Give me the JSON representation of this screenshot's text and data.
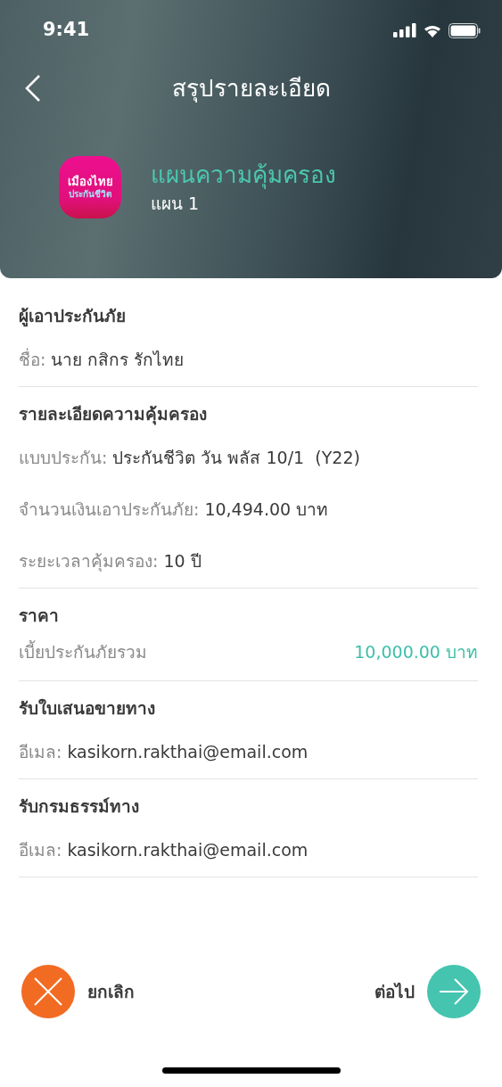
{
  "status_bar": {
    "time": "9:41"
  },
  "header": {
    "title": "สรุปรายละเอียด",
    "logo": {
      "line1": "เมืองไทย",
      "line2": "ประกันชีวิต"
    },
    "plan_name": "แผนความคุ้มครอง",
    "plan_label": "แผน 1"
  },
  "sections": [
    {
      "title": "ผู้เอาประกันภัย",
      "rows": [
        {
          "kind": "field",
          "label": "ชื่อ:",
          "value": "นาย กสิกร รักไทย"
        }
      ]
    },
    {
      "title": "รายละเอียดความคุ้มครอง",
      "rows": [
        {
          "kind": "field",
          "label": "แบบประกัน:",
          "value": "ประกันชีวิต วัน พลัส 10/1  (Y22)"
        },
        {
          "kind": "field",
          "label": "จำนวนเงินเอาประกันภัย:",
          "value": "10,494.00 บาท"
        },
        {
          "kind": "field",
          "label": "ระยะเวลาคุ้มครอง:",
          "value": "10 ปี"
        }
      ]
    },
    {
      "title": "ราคา",
      "rows": [
        {
          "kind": "price",
          "label": "เบี้ยประกันภัยรวม",
          "value": "10,000.00 บาท"
        }
      ]
    },
    {
      "title": "รับใบเสนอขายทาง",
      "rows": [
        {
          "kind": "field",
          "label": "อีเมล:",
          "value": "kasikorn.rakthai@email.com"
        }
      ]
    },
    {
      "title": "รับกรมธรรม์ทาง",
      "rows": [
        {
          "kind": "field",
          "label": "อีเมล:",
          "value": "kasikorn.rakthai@email.com"
        }
      ]
    }
  ],
  "footer": {
    "cancel": "ยกเลิก",
    "next": "ต่อไป"
  }
}
